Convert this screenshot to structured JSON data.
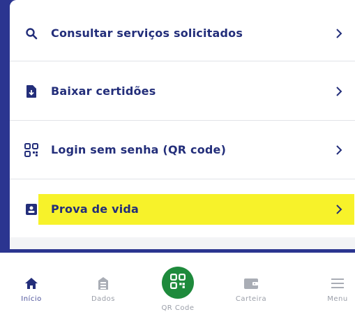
{
  "colors": {
    "background": "#2b3590",
    "accent": "#232e7a",
    "highlight": "#f7f22a",
    "qr_button": "#1e8a3c"
  },
  "menu": {
    "items": [
      {
        "icon": "search-icon",
        "label": "Consultar serviços solicitados"
      },
      {
        "icon": "document-icon",
        "label": "Baixar certidões"
      },
      {
        "icon": "qr-code-icon",
        "label": "Login sem senha (QR code)"
      },
      {
        "icon": "id-badge-icon",
        "label": "Prova de vida",
        "highlighted": true
      }
    ]
  },
  "bottom_nav": {
    "items": [
      {
        "icon": "home-icon",
        "label": "Início",
        "active": true
      },
      {
        "icon": "building-icon",
        "label": "Dados"
      },
      {
        "icon": "qr-code-icon",
        "label": "QR Code"
      },
      {
        "icon": "wallet-icon",
        "label": "Carteira"
      },
      {
        "icon": "menu-icon",
        "label": "Menu"
      }
    ]
  }
}
